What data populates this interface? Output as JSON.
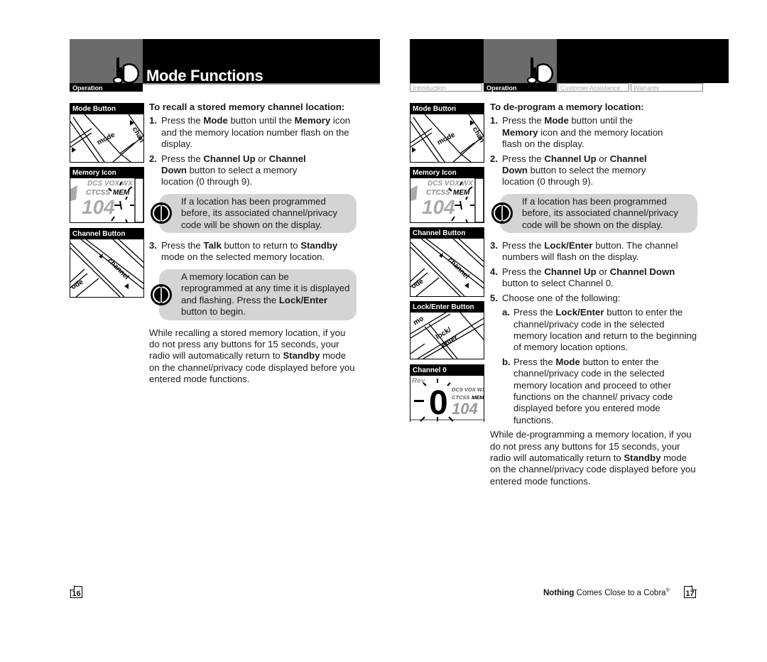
{
  "header": {
    "section_title": "Mode Functions",
    "left_active_tab": "Operation",
    "right_tabs": [
      {
        "label": "Introduction",
        "active": false
      },
      {
        "label": "Operation",
        "active": true
      },
      {
        "label": "Customer Assistance",
        "active": false
      },
      {
        "label": "Warranty",
        "active": false
      }
    ],
    "icon": "radio-operation-icon"
  },
  "left_page": {
    "illustrations": [
      {
        "label": "Mode Button",
        "icon": "mode-button-illustration"
      },
      {
        "label": "Memory Icon",
        "icon": "memory-icon-display-illustration",
        "display": {
          "top": "DCS VOX WX",
          "middle": "CTCSS",
          "mem": "MEM",
          "digits": "104"
        }
      },
      {
        "label": "Channel Button",
        "icon": "channel-button-illustration"
      }
    ],
    "heading": "To recall a stored memory channel location:",
    "steps": [
      {
        "num": "1.",
        "parts": [
          "Press the ",
          "Mode",
          " button until the ",
          "Memory",
          " icon and the memory location number flash on the display."
        ]
      },
      {
        "num": "2.",
        "parts": [
          "Press the ",
          "Channel Up",
          " or ",
          "Channel Down",
          " button to select a memory location (0 through 9)."
        ]
      },
      {
        "num": "3.",
        "parts": [
          "Press the ",
          "Talk",
          " button to return to ",
          "Standby",
          " mode on the selected memory location."
        ]
      }
    ],
    "notes": [
      {
        "text": "If a location has been programmed before, its associated channel/privacy code will be shown on the display."
      },
      {
        "pre": "A memory location can be reprogrammed at any time it is displayed and flashing. Press the ",
        "bold": "Lock/Enter",
        "post": " button to begin."
      }
    ],
    "closing": {
      "pre": "While recalling a stored memory location, if you do not press any buttons for 15 seconds, your radio will automatically return to ",
      "bold": "Standby",
      "post": " mode on the channel/privacy code displayed before you entered mode functions."
    },
    "page_number": "16"
  },
  "right_page": {
    "illustrations": [
      {
        "label": "Mode Button",
        "icon": "mode-button-illustration"
      },
      {
        "label": "Memory Icon",
        "icon": "memory-icon-display-illustration"
      },
      {
        "label": "Channel Button",
        "icon": "channel-button-illustration"
      },
      {
        "label": "Lock/Enter Button",
        "icon": "lock-enter-button-illustration",
        "key_text": [
          "lock/",
          "enter"
        ]
      },
      {
        "label": "Channel 0",
        "icon": "channel-zero-display-illustration",
        "display": {
          "top": "Rev",
          "codes": "DCS VOX WX",
          "middle": "CTCSS",
          "mem": "MEM",
          "digit": "0",
          "small_digits": "104"
        }
      }
    ],
    "heading": "To de-program a memory location:",
    "steps": [
      {
        "num": "1.",
        "parts": [
          "Press the ",
          "Mode",
          " button until the ",
          "Memory",
          " icon and the memory location flash on the display."
        ]
      },
      {
        "num": "2.",
        "parts": [
          "Press the ",
          "Channel Up",
          " or ",
          "Channel Down",
          " button to select the memory location (0 through 9)."
        ]
      },
      {
        "num": "3.",
        "parts": [
          "Press the ",
          "Lock/Enter",
          " button. The channel numbers will flash on the display."
        ]
      },
      {
        "num": "4.",
        "parts": [
          "Press the ",
          "Channel Up",
          " or ",
          "Channel Down",
          " button to select Channel 0."
        ]
      },
      {
        "num": "5.",
        "parts": [
          "Choose one of the following:"
        ]
      }
    ],
    "substeps": [
      {
        "num": "a.",
        "parts": [
          "Press the ",
          "Lock/Enter",
          " button to enter the channel/privacy code in the selected memory location and return to the beginning of memory location options."
        ]
      },
      {
        "num": "b.",
        "parts": [
          "Press the ",
          "Mode",
          " button to enter the channel/privacy code in the selected memory location and proceed to other functions on the channel/ privacy code displayed before you entered mode functions."
        ]
      }
    ],
    "note": {
      "text": "If a location has been programmed before, its associated channel/privacy code will be shown on the display."
    },
    "closing": {
      "pre": "While de-programming a memory location, if you do not press any buttons for 15 seconds, your radio will automatically return to ",
      "bold": "Standby",
      "post": " mode on the channel/privacy code displayed before you entered mode functions."
    },
    "footer": {
      "bold": "Nothing",
      "text": " Comes Close to a Cobra",
      "reg": "®"
    },
    "page_number": "17"
  }
}
